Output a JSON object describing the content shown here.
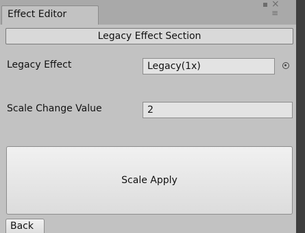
{
  "window": {
    "tab_title": "Effect Editor"
  },
  "section": {
    "header": "Legacy Effect Section"
  },
  "fields": {
    "legacy_effect_label": "Legacy Effect",
    "legacy_effect_value": "Legacy(1x)",
    "scale_change_label": "Scale Change Value",
    "scale_change_value": "2"
  },
  "buttons": {
    "scale_apply": "Scale Apply",
    "back": "Back"
  },
  "icons": {
    "object_picker": "object-picker-icon",
    "maximize": "maximize-icon",
    "close": "close-icon",
    "tab_menu": "tab-menu-icon"
  }
}
